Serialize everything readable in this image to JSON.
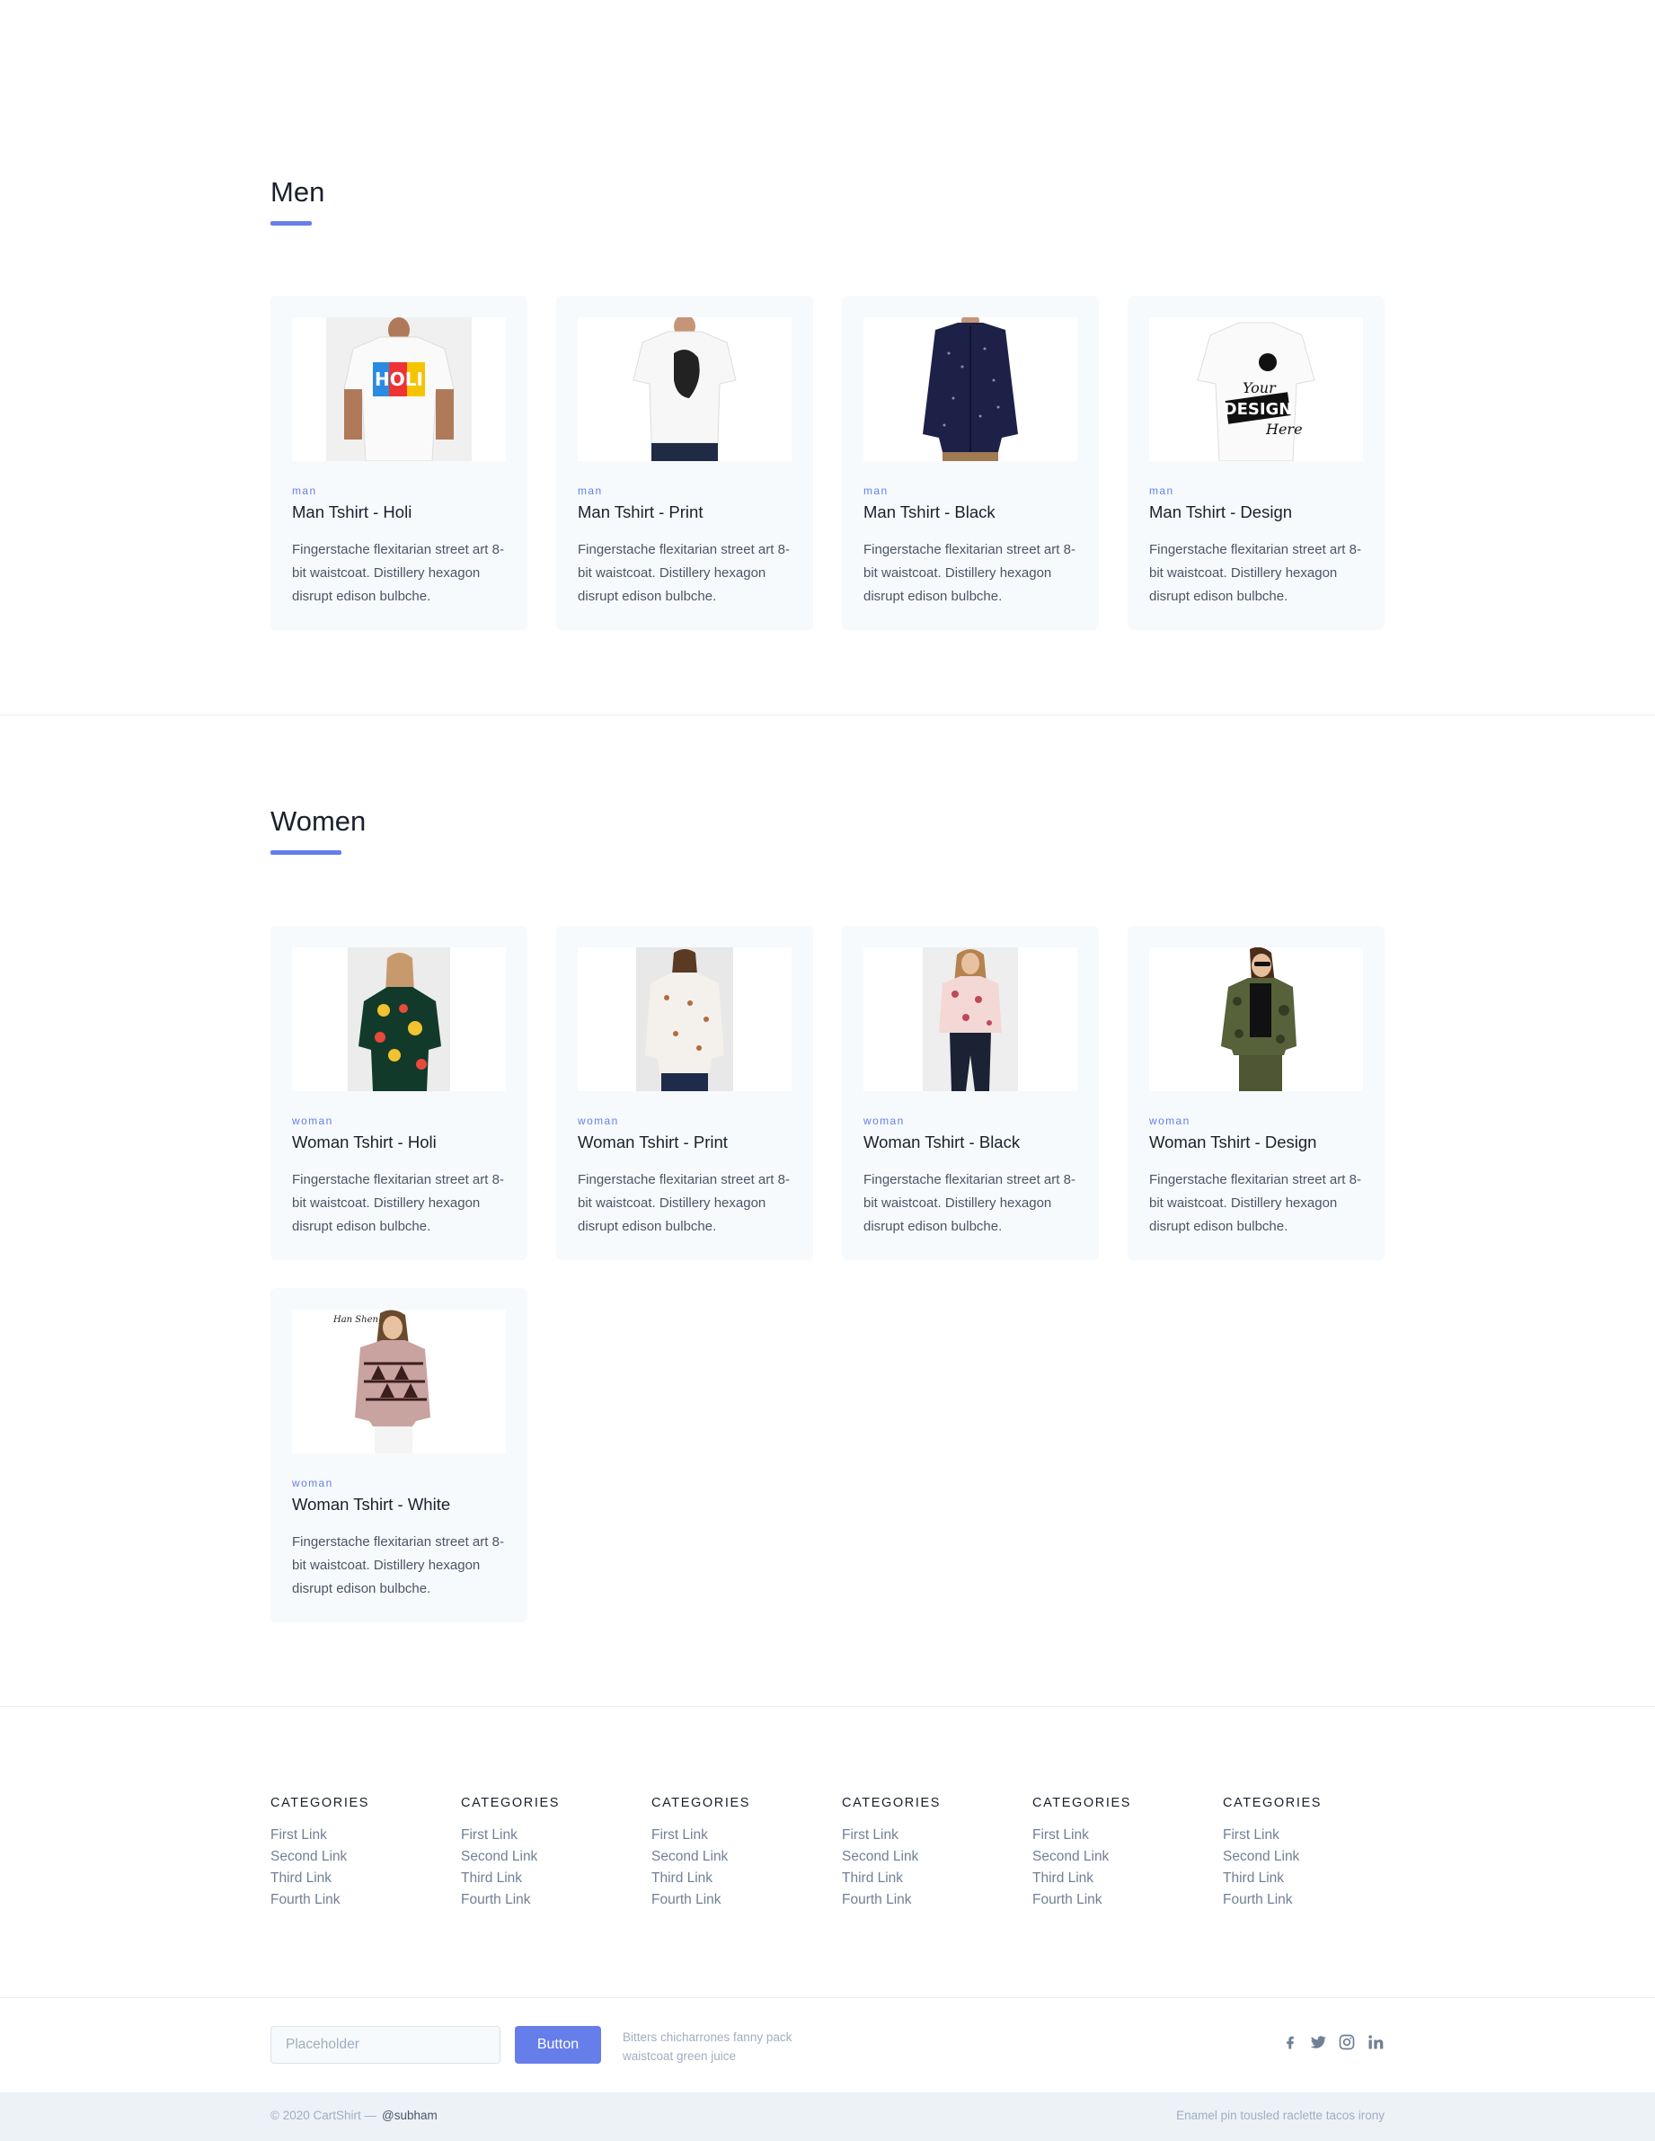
{
  "men": {
    "title": "Men",
    "products": [
      {
        "category": "man",
        "name": "Man Tshirt - Holi",
        "description": "Fingerstache flexitarian street art 8-bit waistcoat. Distillery hexagon disrupt edison bulbche."
      },
      {
        "category": "man",
        "name": "Man Tshirt - Print",
        "description": "Fingerstache flexitarian street art 8-bit waistcoat. Distillery hexagon disrupt edison bulbche."
      },
      {
        "category": "man",
        "name": "Man Tshirt - Black",
        "description": "Fingerstache flexitarian street art 8-bit waistcoat. Distillery hexagon disrupt edison bulbche."
      },
      {
        "category": "man",
        "name": "Man Tshirt - Design",
        "description": "Fingerstache flexitarian street art 8-bit waistcoat. Distillery hexagon disrupt edison bulbche."
      }
    ]
  },
  "women": {
    "title": "Women",
    "products": [
      {
        "category": "woman",
        "name": "Woman Tshirt - Holi",
        "description": "Fingerstache flexitarian street art 8-bit waistcoat. Distillery hexagon disrupt edison bulbche."
      },
      {
        "category": "woman",
        "name": "Woman Tshirt - Print",
        "description": "Fingerstache flexitarian street art 8-bit waistcoat. Distillery hexagon disrupt edison bulbche."
      },
      {
        "category": "woman",
        "name": "Woman Tshirt - Black",
        "description": "Fingerstache flexitarian street art 8-bit waistcoat. Distillery hexagon disrupt edison bulbche."
      },
      {
        "category": "woman",
        "name": "Woman Tshirt - Design",
        "description": "Fingerstache flexitarian street art 8-bit waistcoat. Distillery hexagon disrupt edison bulbche."
      },
      {
        "category": "woman",
        "name": "Woman Tshirt - White",
        "description": "Fingerstache flexitarian street art 8-bit waistcoat. Distillery hexagon disrupt edison bulbche."
      }
    ]
  },
  "footer": {
    "columns": [
      {
        "heading": "CATEGORIES",
        "links": [
          "First Link",
          "Second Link",
          "Third Link",
          "Fourth Link"
        ]
      },
      {
        "heading": "CATEGORIES",
        "links": [
          "First Link",
          "Second Link",
          "Third Link",
          "Fourth Link"
        ]
      },
      {
        "heading": "CATEGORIES",
        "links": [
          "First Link",
          "Second Link",
          "Third Link",
          "Fourth Link"
        ]
      },
      {
        "heading": "CATEGORIES",
        "links": [
          "First Link",
          "Second Link",
          "Third Link",
          "Fourth Link"
        ]
      },
      {
        "heading": "CATEGORIES",
        "links": [
          "First Link",
          "Second Link",
          "Third Link",
          "Fourth Link"
        ]
      },
      {
        "heading": "CATEGORIES",
        "links": [
          "First Link",
          "Second Link",
          "Third Link",
          "Fourth Link"
        ]
      }
    ],
    "newsletter": {
      "placeholder": "Placeholder",
      "button_label": "Button",
      "text": "Bitters chicharrones fanny pack waistcoat green juice"
    },
    "social_icons": [
      "facebook-icon",
      "twitter-icon",
      "instagram-icon",
      "linkedin-icon"
    ],
    "copyright": "© 2020 CartShirt —",
    "handle": "@subham",
    "tagline": "Enamel pin tousled raclette tacos irony"
  },
  "colors": {
    "accent": "#667eea",
    "card_bg": "#f7fafc",
    "bottom_bar_bg": "#edf2f7"
  }
}
